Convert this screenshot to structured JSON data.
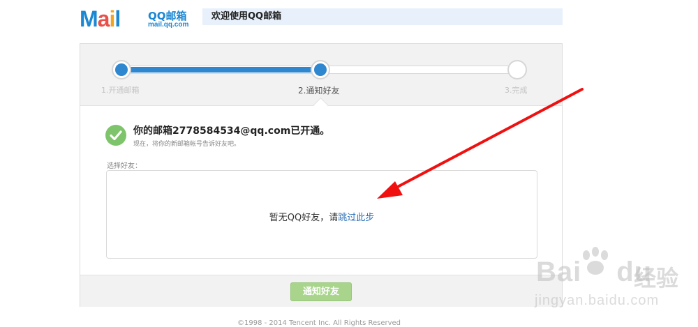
{
  "header": {
    "logo_letters": [
      "M",
      "a",
      "i",
      "l"
    ],
    "logo_cn": "QQ邮箱",
    "logo_url": "mail.qq.com",
    "welcome": "欢迎使用QQ邮箱"
  },
  "steps": [
    {
      "label": "1.开通邮箱",
      "state": "done"
    },
    {
      "label": "2.通知好友",
      "state": "current"
    },
    {
      "label": "3.完成",
      "state": "pending"
    }
  ],
  "progress_fraction": 0.5,
  "status": {
    "title": "你的邮箱2778584534@qq.com已开通。",
    "subtitle": "现在，将你的新邮箱帐号告诉好友吧。"
  },
  "friends": {
    "label": "选择好友：",
    "empty_text": "暂无QQ好友，请",
    "skip_link": "跳过此步"
  },
  "actions": {
    "notify_button": "通知好友"
  },
  "footer": {
    "copyright": "©1998 - 2014 Tencent Inc. All Rights Reserved"
  },
  "watermark": {
    "brand": "Bai",
    "brand2": "du",
    "cn": "经验",
    "url": "jingyan.baidu.com"
  },
  "colors": {
    "accent": "#2e87cf",
    "success": "#7ec46b",
    "button": "#a9d48c",
    "annotation_arrow": "#f01010"
  }
}
